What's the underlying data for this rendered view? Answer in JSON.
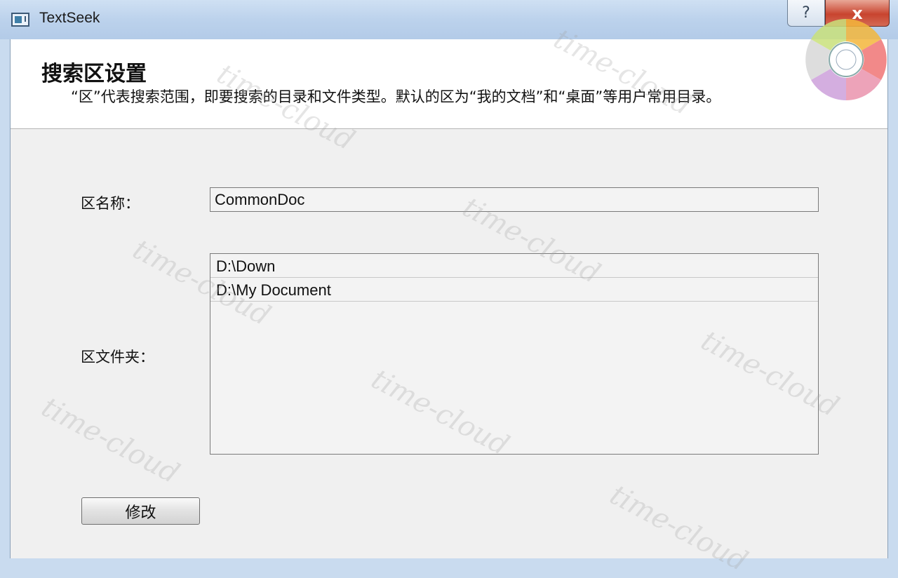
{
  "window": {
    "title": "TextSeek",
    "help_label": "?",
    "close_label": "x"
  },
  "header": {
    "title": "搜索区设置",
    "description": "“区”代表搜索范围，即要搜索的目录和文件类型。默认的区为“我的文档”和“桌面”等用户常用目录。"
  },
  "form": {
    "name_label": "区名称：",
    "name_value": "CommonDoc",
    "folders_label": "区文件夹：",
    "folders": [
      "D:\\Down",
      "D:\\My Document"
    ],
    "modify_button": "修改"
  },
  "watermark": "time-cloud"
}
